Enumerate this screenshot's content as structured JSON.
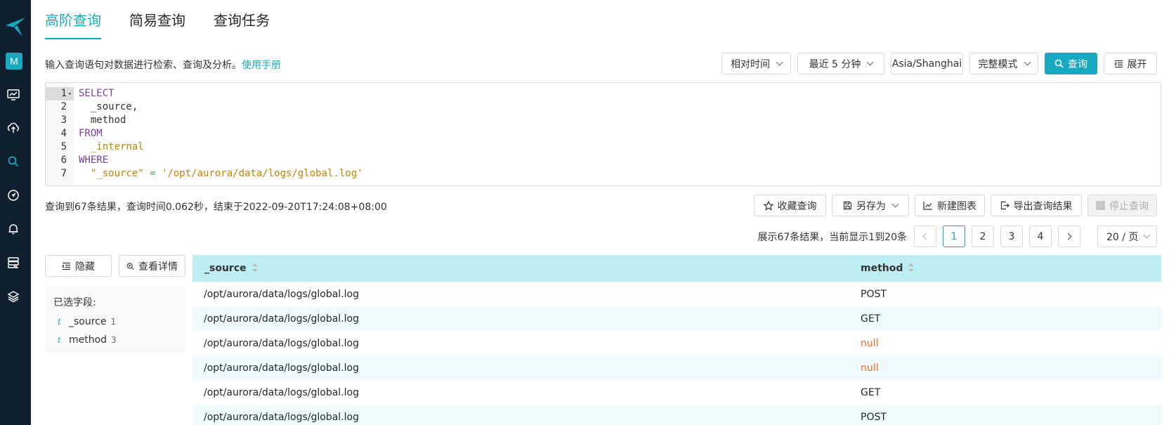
{
  "tabs": [
    "高阶查询",
    "简易查询",
    "查询任务"
  ],
  "avatar_letter": "M",
  "hint": {
    "text": "输入查询语句对数据进行检索、查询及分析。",
    "link": "使用手册"
  },
  "toolbar": {
    "time_type": "相对时间",
    "time_range": "最近 5 分钟",
    "timezone": "Asia/Shanghai",
    "mode": "完整模式",
    "query_label": "查询",
    "expand_label": "展开"
  },
  "editor": {
    "lines": [
      {
        "num": "1",
        "parts": [
          {
            "cls": "kw",
            "text": "SELECT"
          }
        ]
      },
      {
        "num": "2",
        "parts": [
          {
            "cls": "op",
            "text": "  _source,"
          }
        ]
      },
      {
        "num": "3",
        "parts": [
          {
            "cls": "op",
            "text": "  method"
          }
        ]
      },
      {
        "num": "4",
        "parts": [
          {
            "cls": "kw",
            "text": "FROM"
          }
        ]
      },
      {
        "num": "5",
        "parts": [
          {
            "cls": "tb",
            "text": "  _internal"
          }
        ]
      },
      {
        "num": "6",
        "parts": [
          {
            "cls": "kw",
            "text": "WHERE"
          }
        ]
      },
      {
        "num": "7",
        "parts": [
          {
            "cls": "tb",
            "text": "  \"_source\""
          },
          {
            "cls": "str",
            "text": " = "
          },
          {
            "cls": "tb",
            "text": "'/opt/aurora/data/logs/global.log'"
          }
        ]
      }
    ]
  },
  "status": "查询到67条结果，查询时间0.062秒，结束于2022-09-20T17:24:08+08:00",
  "actions": {
    "favorite": "收藏查询",
    "save_as": "另存为",
    "new_chart": "新建图表",
    "export": "导出查询结果",
    "stop": "停止查询"
  },
  "pager": {
    "info": "展示67条结果，当前显示1到20条",
    "pages": [
      "1",
      "2",
      "3",
      "4"
    ],
    "size": "20 / 页"
  },
  "side": {
    "hide_label": "隐藏",
    "detail_label": "查看详情",
    "fields_title": "已选字段:",
    "fields": [
      {
        "type": "t",
        "name": "_source",
        "count": "1"
      },
      {
        "type": "t",
        "name": "method",
        "count": "3"
      }
    ]
  },
  "table": {
    "columns": [
      "_source",
      "method"
    ],
    "rows": [
      [
        "/opt/aurora/data/logs/global.log",
        "POST"
      ],
      [
        "/opt/aurora/data/logs/global.log",
        "GET"
      ],
      [
        "/opt/aurora/data/logs/global.log",
        "null"
      ],
      [
        "/opt/aurora/data/logs/global.log",
        "null"
      ],
      [
        "/opt/aurora/data/logs/global.log",
        "GET"
      ],
      [
        "/opt/aurora/data/logs/global.log",
        "POST"
      ]
    ]
  },
  "colors": {
    "accent": "#17a9c0",
    "sidebar": "#0f1f2d",
    "null": "#f06b24",
    "header": "#bdeef3"
  }
}
